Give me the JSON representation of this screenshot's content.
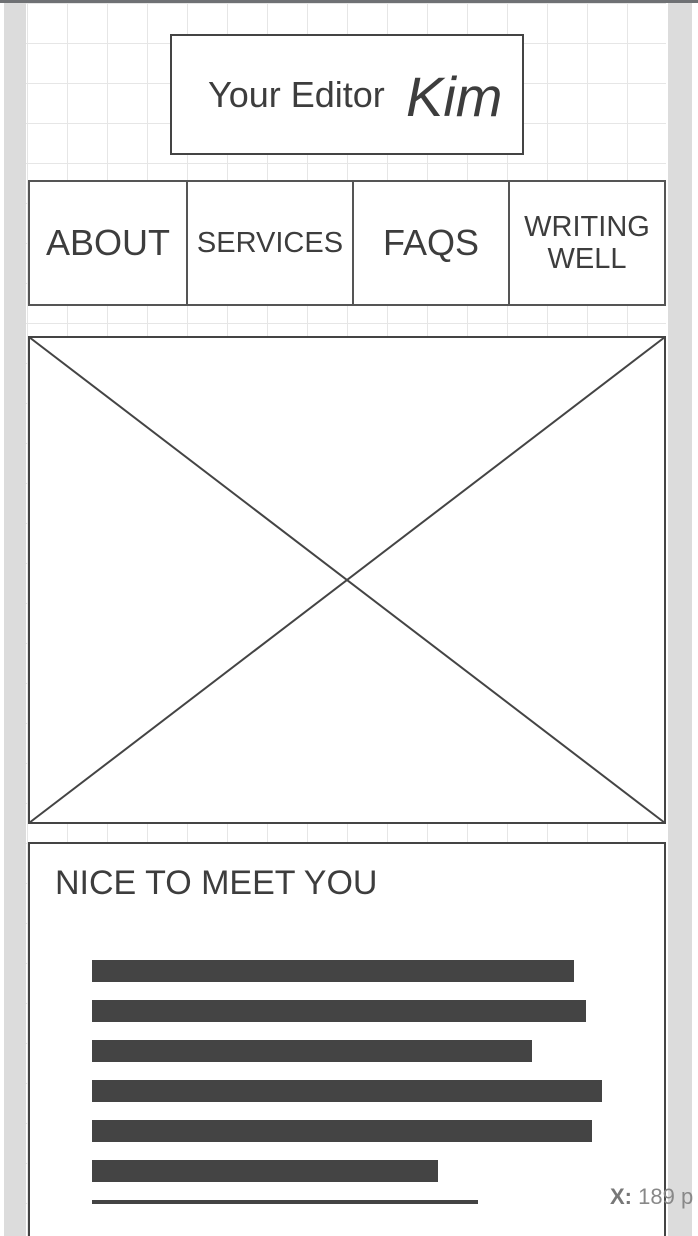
{
  "logo": {
    "prefix": "Your Editor",
    "name": "Kim"
  },
  "nav": {
    "items": [
      {
        "label": "ABOUT"
      },
      {
        "label": "SERVICES"
      },
      {
        "label": "FAQS"
      },
      {
        "label_line1": "WRITING",
        "label_line2": "WELL"
      }
    ]
  },
  "hero": {
    "icon": "image-placeholder-icon"
  },
  "intro": {
    "heading": "NICE TO MEET YOU",
    "placeholder_lines": 7
  },
  "status": {
    "x_label": "X:",
    "x_value": "189 p"
  },
  "colors": {
    "stroke": "#444444",
    "grid": "#e6e6e6",
    "rail": "#dcdcdc"
  }
}
